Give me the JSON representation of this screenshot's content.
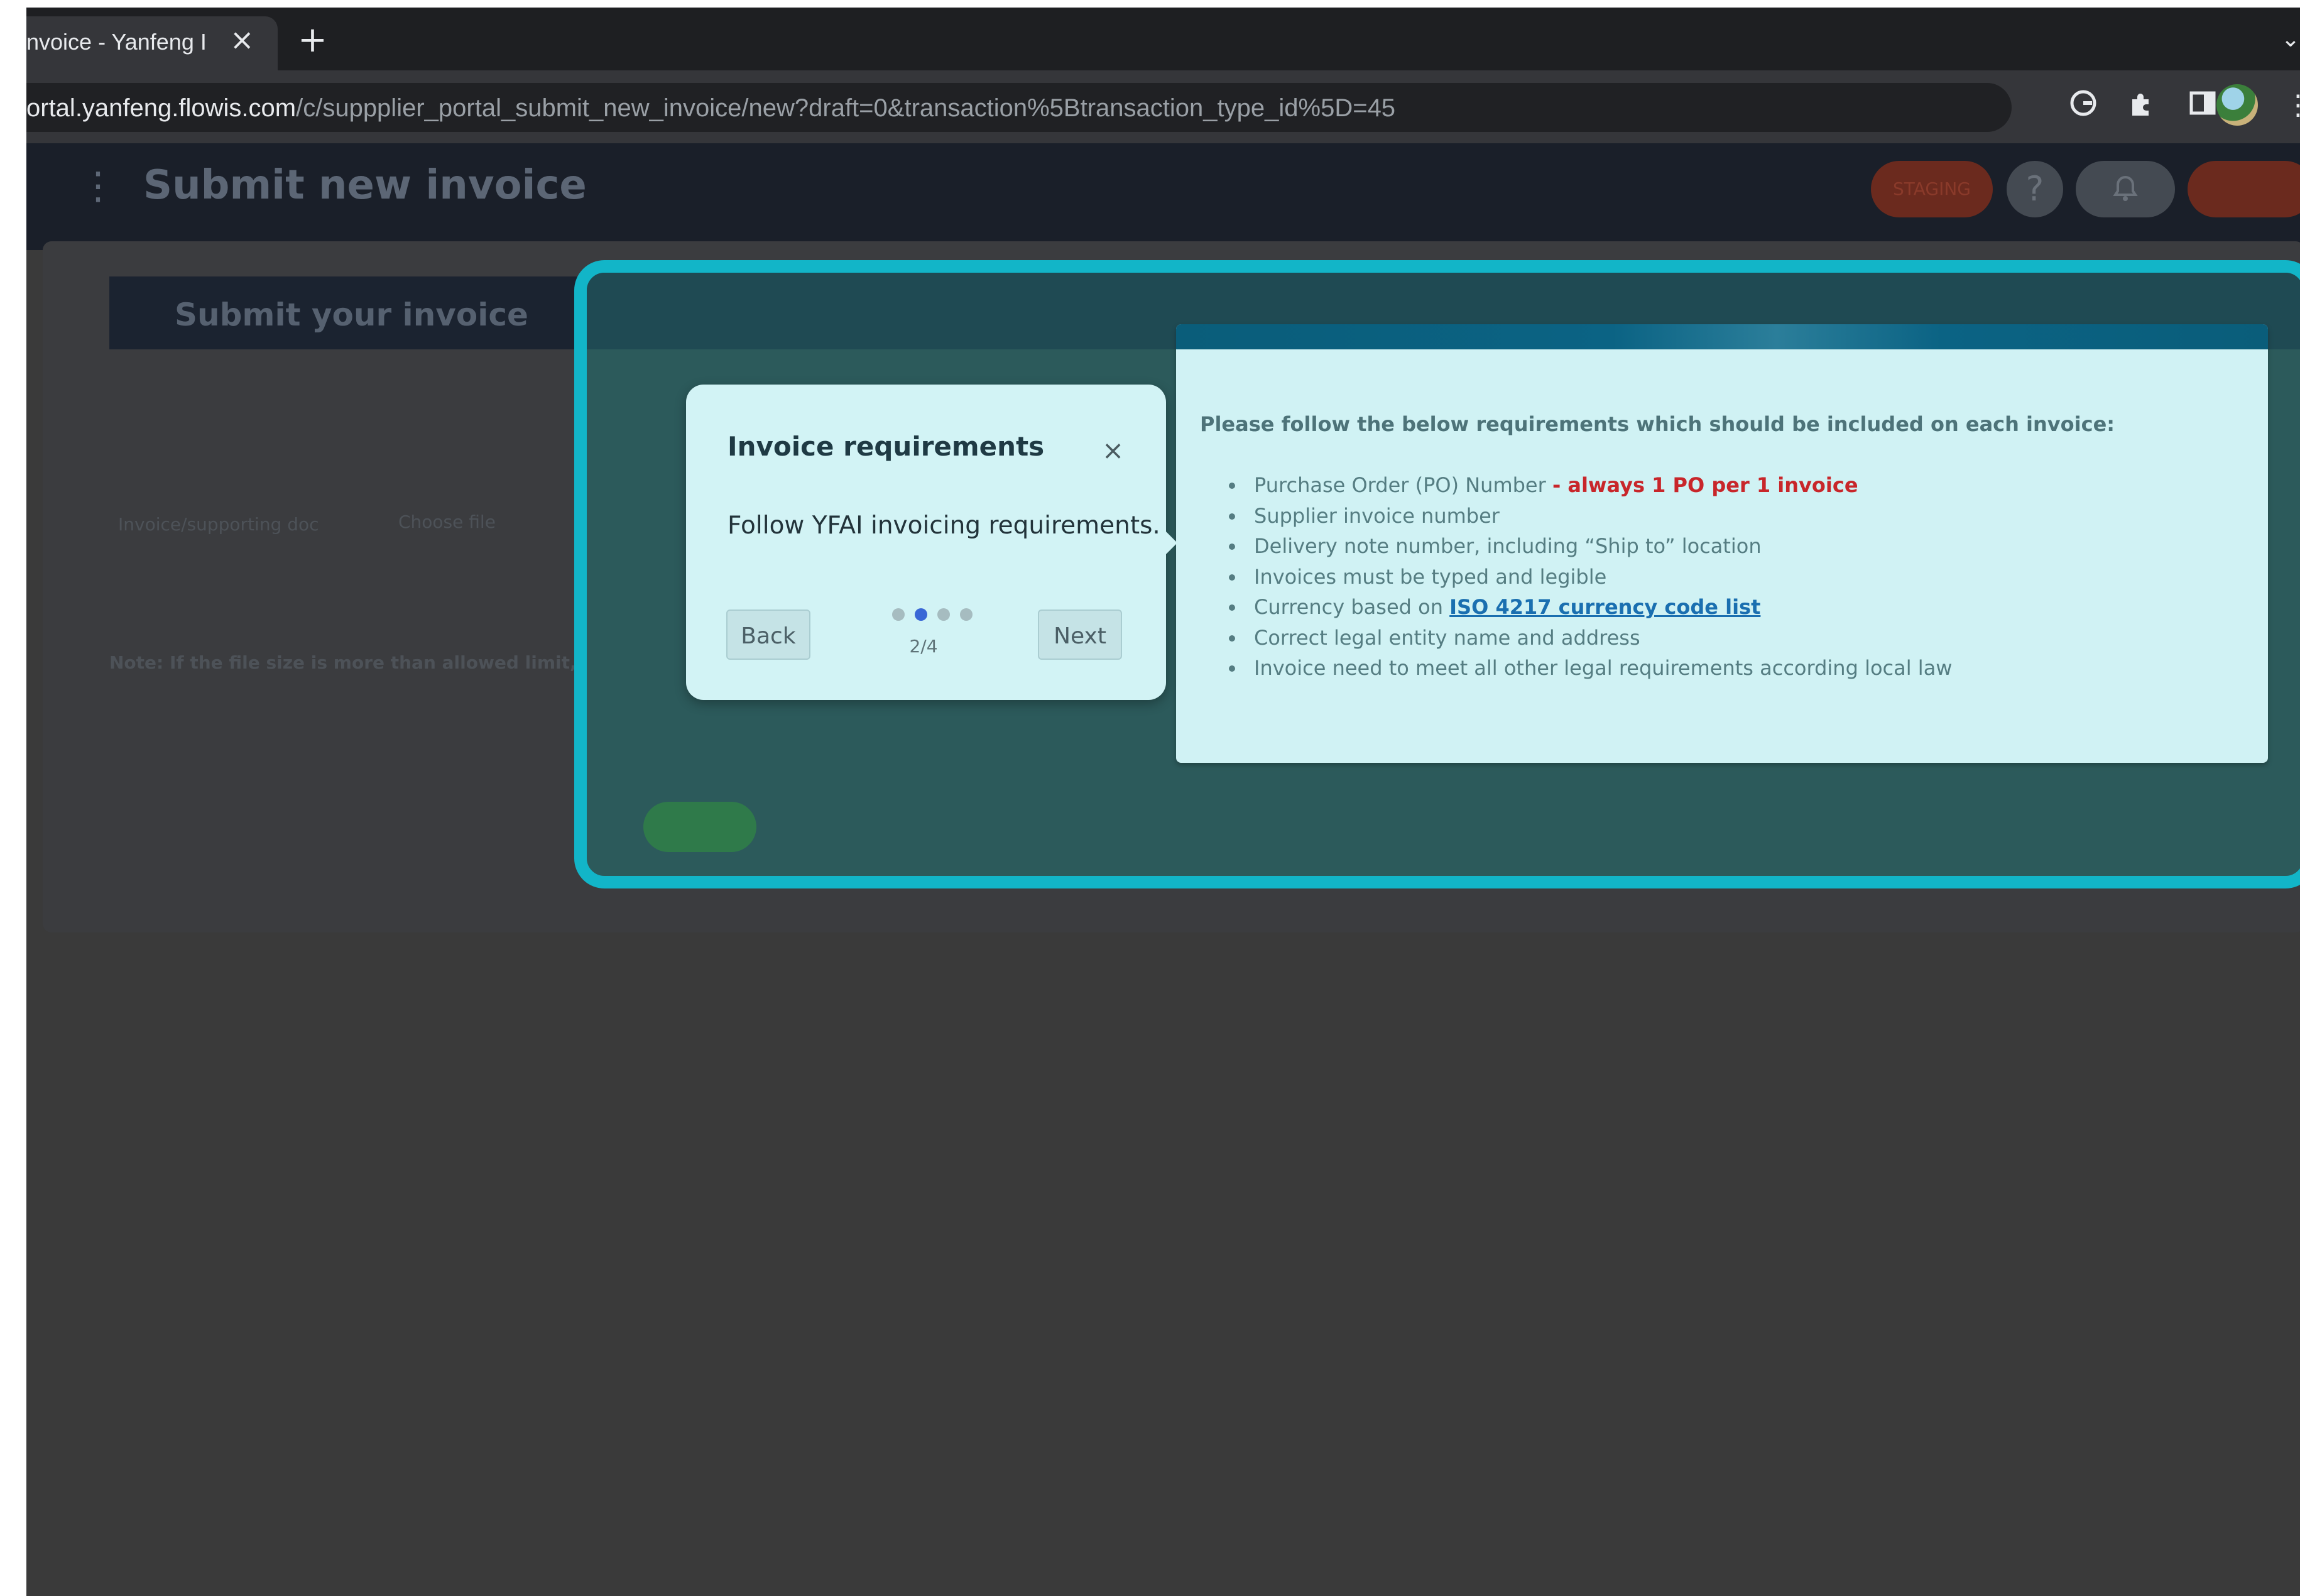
{
  "browser": {
    "tab_title": "nvoice - Yanfeng I",
    "tab_close": "×",
    "new_tab": "+",
    "url_host": "ortal.yanfeng.flowis.com",
    "url_path": "/c/suppplier_portal_submit_new_invoice/new?draft=0&transaction%5Btransaction_type_id%5D=45",
    "icons": [
      "google-lens-icon",
      "extensions-puzzle-icon",
      "side-panel-icon",
      "profile-avatar",
      "browser-menu-icon"
    ]
  },
  "header": {
    "menu_icon": "⋮",
    "title": "Submit new invoice",
    "staging_badge": "STAGING",
    "help_icon": "?",
    "bell_icon": "🔔"
  },
  "page": {
    "section_title": "Submit your invoice",
    "upload_label": "Invoice/supporting doc",
    "choose_file": "Choose file",
    "note": "Note: If the file size is more than allowed limit, split it up."
  },
  "requirements": {
    "heading": "Please follow the below requirements which should be included on each invoice:",
    "items": [
      {
        "text": "Purchase Order (PO) Number ",
        "emphasis": "- always 1 PO per 1 invoice"
      },
      {
        "text": "Supplier invoice number"
      },
      {
        "text": "Delivery note number, including “Ship to” location"
      },
      {
        "text": "Invoices must be typed and legible"
      },
      {
        "text": "Currency based on ",
        "link": "ISO 4217 currency code list"
      },
      {
        "text": "Correct legal entity name and address"
      },
      {
        "text": "Invoice need to meet all other legal requirements according local law"
      }
    ],
    "emphasis_color": "#c8262a",
    "link_color": "#1a6fb0"
  },
  "tour": {
    "title": "Invoice requirements",
    "close": "×",
    "body": "Follow YFAI invoicing requirements.",
    "back_label": "Back",
    "next_label": "Next",
    "step_current": 2,
    "step_total": 4,
    "step_text": "2/4",
    "highlight_color": "#12b5c8"
  }
}
